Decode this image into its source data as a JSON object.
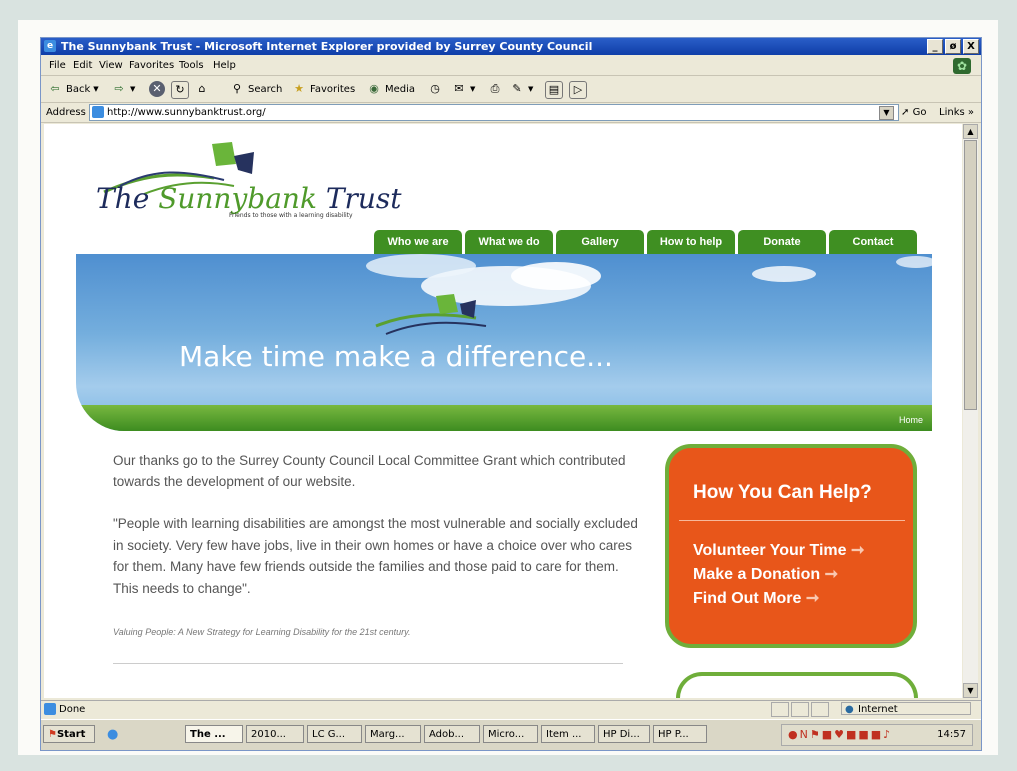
{
  "browser": {
    "title": "The Sunnybank Trust - Microsoft Internet Explorer provided by Surrey County Council",
    "window_buttons": [
      "_",
      "ø",
      "X"
    ],
    "menu": [
      "File",
      "Edit",
      "View",
      "Favorites",
      "Tools",
      "Help"
    ],
    "toolbar": {
      "back": "Back",
      "search": "Search",
      "favorites": "Favorites",
      "media": "Media"
    },
    "address_label": "Address",
    "url": "http://www.sunnybanktrust.org/",
    "go": "Go",
    "links": "Links »",
    "status": "Done",
    "zone": "Internet"
  },
  "site": {
    "logo_the": "The",
    "logo_sunnybank": "Sunnybank",
    "logo_trust": "Trust",
    "tagline": "Friends to those with a learning disability",
    "nav": [
      "Who we are",
      "What we do",
      "Gallery",
      "How to help",
      "Donate",
      "Contact"
    ],
    "banner_text": "Make time make a difference...",
    "breadcrumb": "Home",
    "para1": "Our thanks go to the Surrey County Council Local Committee Grant which contributed towards the development of our website.",
    "para2": "\"People with learning disabilities are amongst the most vulnerable and socially excluded in society. Very few have jobs, live in their own homes or have a choice over who cares for them. Many have few friends outside the families and those paid to care for them. This needs to change\".",
    "citation": "Valuing People: A New Strategy for Learning Disability for the 21st century.",
    "help": {
      "heading": "How You Can Help?",
      "links": [
        "Volunteer Your Time",
        "Make a Donation",
        "Find Out More"
      ],
      "arrow": "➞"
    }
  },
  "taskbar": {
    "start": "Start",
    "tasks": [
      "The ...",
      "2010...",
      "LC G...",
      "Marg...",
      "Adob...",
      "Micro...",
      "Item ...",
      "HP Di...",
      "HP P..."
    ],
    "time": "14:57"
  },
  "colors": {
    "nav_green": "#3f8f22",
    "help_orange": "#e8561a",
    "help_border": "#6fae3a",
    "titlebar_blue": "#0f3ea8"
  }
}
